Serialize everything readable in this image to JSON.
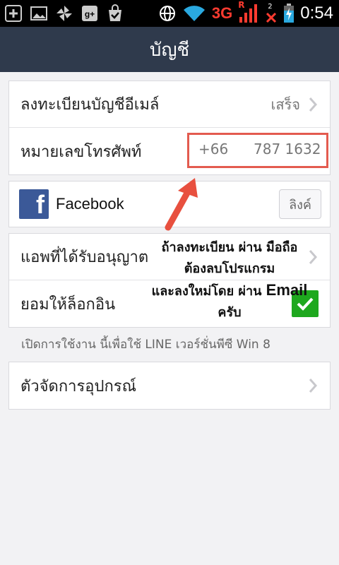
{
  "status_bar": {
    "left_icons": [
      "add-icon",
      "image-icon",
      "pinwheel-icon",
      "google-plus-icon",
      "bag-check-icon"
    ],
    "right_icons": [
      "globe-icon",
      "wifi-icon",
      "signal-icon",
      "missed-call-icon",
      "battery-icon"
    ],
    "network_label": "3G",
    "roaming_label": "R",
    "missed_count": "2",
    "time": "0:54"
  },
  "header": {
    "title": "บัญชี"
  },
  "account_card": {
    "email_row": {
      "label": "ลงทะเบียนบัญชีอีเมล์",
      "status": "เสร็จ"
    },
    "phone_row": {
      "label": "หมายเลขโทรศัพท์",
      "country_code": "+66",
      "number": "787 1632"
    }
  },
  "facebook_card": {
    "label": "Facebook",
    "link_button": "ลิงค์"
  },
  "apps_card": {
    "authorized_row": {
      "label": "แอพที่ได้รับอนุญาต"
    },
    "allow_login_row": {
      "label": "ยอมให้ล็อกอิน",
      "checked": true
    }
  },
  "note": "เปิดการใช้งาน นี้เพื่อใช้ LINE เวอร์ชั่นพีซี Win 8",
  "device_card": {
    "label": "ตัวจัดการอุปกรณ์"
  },
  "annotation": {
    "line1": "ถ้าลงทะเบียน ผ่าน มือถือ",
    "line2": "ต้องลบโปรแกรม",
    "line3_prefix": "และลงใหม่โดย ผ่าน ",
    "line3_email": "Email",
    "line4": "ครับ"
  },
  "colors": {
    "header_bg": "#2f3a4c",
    "highlight_border": "#e35b4f",
    "checkbox_green": "#1ea81e",
    "facebook_blue": "#3b5998",
    "arrow": "#e8503f"
  }
}
